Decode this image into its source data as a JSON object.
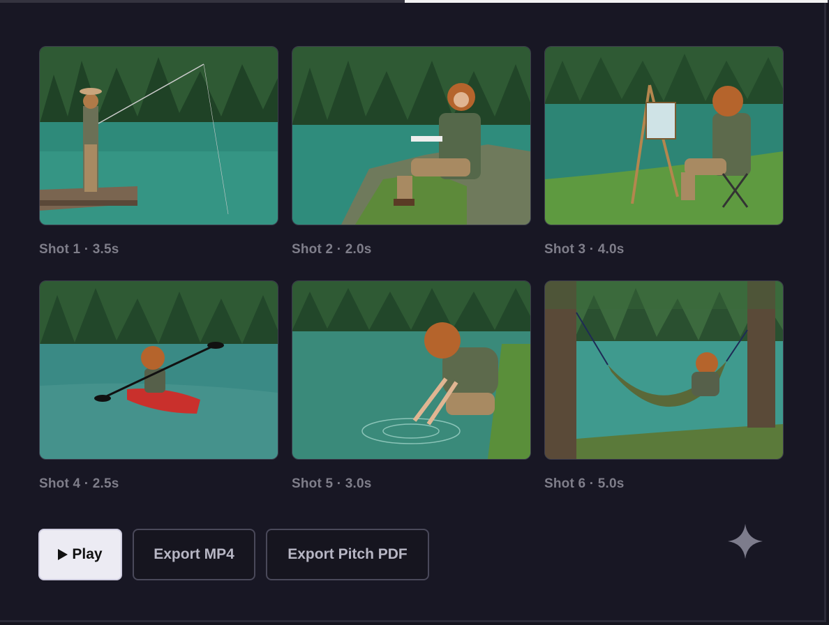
{
  "shots": [
    {
      "caption": "Shot 1 · 3.5s",
      "scene": "fishing-on-dock"
    },
    {
      "caption": "Shot 2 · 2.0s",
      "scene": "sketching-on-rock"
    },
    {
      "caption": "Shot 3 · 4.0s",
      "scene": "painting-at-easel"
    },
    {
      "caption": "Shot 4 · 2.5s",
      "scene": "kayaking"
    },
    {
      "caption": "Shot 5 · 3.0s",
      "scene": "touching-water"
    },
    {
      "caption": "Shot 6 · 5.0s",
      "scene": "reading-in-hammock"
    }
  ],
  "actions": {
    "play_label": "Play",
    "export_mp4_label": "Export MP4",
    "export_pdf_label": "Export Pitch PDF"
  },
  "icons": {
    "play": "play-icon",
    "sparkle": "sparkle-icon"
  },
  "colors": {
    "background": "#181724",
    "accent_button": "#ecebf3",
    "caption_text": "#7f7e8a"
  }
}
